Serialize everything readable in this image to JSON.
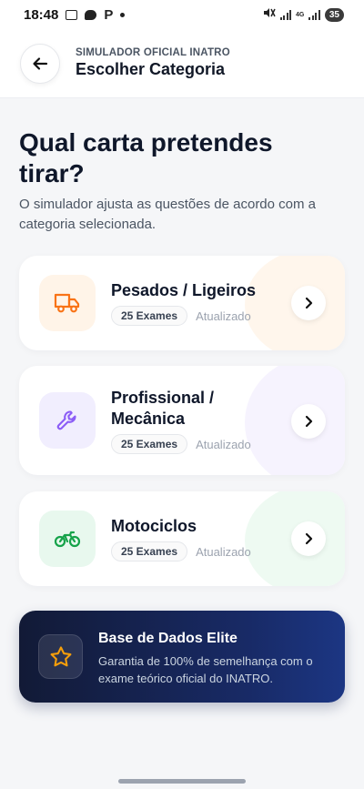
{
  "status_bar": {
    "time": "18:48",
    "p_label": "P",
    "net_label": "4G",
    "battery": "35"
  },
  "header": {
    "subtitle": "SIMULADOR OFICIAL INATRO",
    "title": "Escolher Categoria",
    "back_icon": "arrow-left-icon"
  },
  "intro": {
    "title": "Qual carta pretendes tirar?",
    "description": "O simulador ajusta as questões de acordo com a categoria selecionada."
  },
  "categories": [
    {
      "title": "Pesados / Ligeiros",
      "exams": "25 Exames",
      "status": "Atualizado",
      "icon": "truck-icon",
      "accent": "#f97316",
      "icon_bg": "#fff4e8",
      "blob": "#fff6ec"
    },
    {
      "title": "Profissional / Mecânica",
      "exams": "25 Exames",
      "status": "Atualizado",
      "icon": "wrench-icon",
      "accent": "#8b5cf6",
      "icon_bg": "#f1eefe",
      "blob": "#f6f3fe"
    },
    {
      "title": "Motociclos",
      "exams": "25 Exames",
      "status": "Atualizado",
      "icon": "bike-icon",
      "accent": "#16a34a",
      "icon_bg": "#e8f8ee",
      "blob": "#eefaf2"
    }
  ],
  "elite": {
    "title": "Base de Dados Elite",
    "description": "Garantia de 100% de semelhança com o exame teórico oficial do INATRO.",
    "icon": "star-icon",
    "accent": "#f59e0b"
  }
}
